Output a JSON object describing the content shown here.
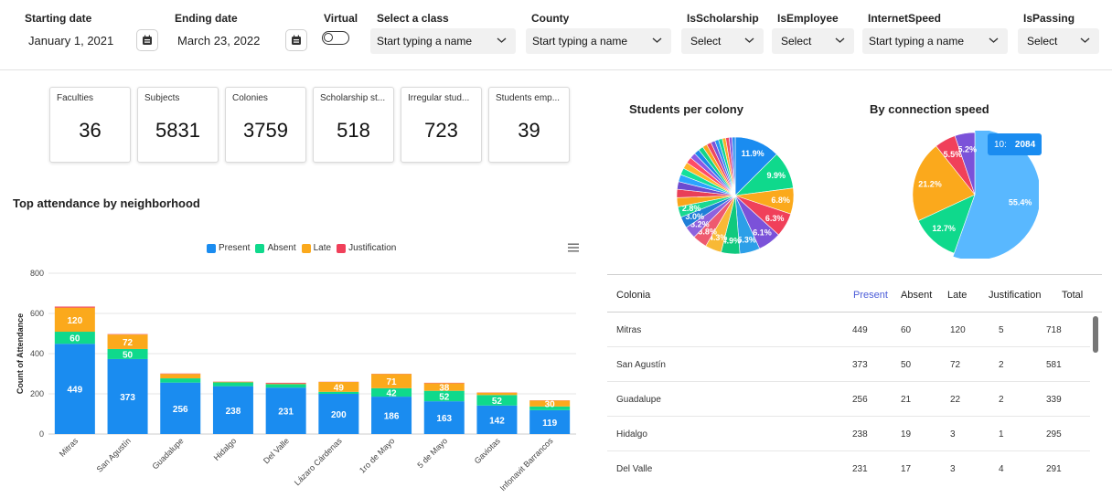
{
  "filters": {
    "start_label": "Starting date",
    "start_value": "January 1, 2021",
    "end_label": "Ending date",
    "end_value": "March 23, 2022",
    "virtual_label": "Virtual",
    "class_label": "Select a class",
    "class_placeholder": "Start typing a name",
    "county_label": "County",
    "county_placeholder": "Start typing a name",
    "scholarship_label": "IsScholarship",
    "scholarship_value": "Select",
    "employee_label": "IsEmployee",
    "employee_value": "Select",
    "internet_label": "InternetSpeed",
    "internet_placeholder": "Start typing a name",
    "passing_label": "IsPassing",
    "passing_value": "Select",
    "icons": {
      "calendar": "calendar-icon",
      "chevron": "chevron-down-icon"
    }
  },
  "kpis": [
    {
      "title": "Faculties",
      "value": "36"
    },
    {
      "title": "Subjects",
      "value": "5831"
    },
    {
      "title": "Colonies",
      "value": "3759"
    },
    {
      "title": "Scholarship st...",
      "value": "518"
    },
    {
      "title": "Irregular stud...",
      "value": "723"
    },
    {
      "title": "Students emp...",
      "value": "39"
    }
  ],
  "attendance_chart": {
    "title": "Top attendance by neighborhood",
    "legend": [
      "Present",
      "Absent",
      "Late",
      "Justification"
    ]
  },
  "pie1_title": "Students per colony",
  "pie2_title": "By connection speed",
  "tooltip": {
    "label": "10:",
    "value": "2084"
  },
  "chart_data": [
    {
      "type": "bar",
      "stacked": true,
      "title": "Top attendance by neighborhood",
      "ylabel": "Count of Attendance",
      "ylim": [
        0,
        800
      ],
      "yticks": [
        0,
        200,
        400,
        600,
        800
      ],
      "categories": [
        "Mitras",
        "San Agustín",
        "Guadalupe",
        "Hidalgo",
        "Del Valle",
        "Lázaro Cárdenas",
        "1ro de Mayo",
        "5 de Mayo",
        "Gaviotas",
        "Infonavit Barrancos"
      ],
      "series": [
        {
          "name": "Present",
          "color": "#1a8cf0",
          "values": [
            449,
            373,
            256,
            238,
            231,
            200,
            186,
            163,
            142,
            119
          ]
        },
        {
          "name": "Absent",
          "color": "#0fd98c",
          "values": [
            60,
            50,
            21,
            19,
            17,
            10,
            42,
            52,
            52,
            18
          ]
        },
        {
          "name": "Late",
          "color": "#fba91c",
          "values": [
            120,
            72,
            22,
            3,
            3,
            49,
            71,
            38,
            12,
            30
          ]
        },
        {
          "name": "Justification",
          "color": "#f0405a",
          "values": [
            5,
            2,
            2,
            1,
            4,
            1,
            1,
            2,
            1,
            1
          ]
        }
      ],
      "labels_shown_threshold": 25,
      "legend_position": "top"
    },
    {
      "type": "pie",
      "title": "Students per colony",
      "labels_visible": [
        "11.9%",
        "9.9%",
        "6.8%",
        "6.3%",
        "6.1%",
        "5.3%",
        "4.9%",
        "4.3%",
        "3.8%",
        "3.2%",
        "3.0%",
        "2.8%"
      ],
      "values": [
        11.9,
        9.9,
        6.8,
        6.3,
        6.1,
        5.3,
        4.9,
        4.3,
        3.8,
        3.2,
        3.0,
        2.8,
        2.4,
        2.2,
        2.0,
        1.9,
        1.8,
        1.7,
        1.6,
        1.5,
        1.4,
        1.3,
        1.2,
        1.2,
        1.1,
        1.0,
        1.0,
        0.9,
        0.9,
        0.8,
        0.8
      ],
      "colors": [
        "#1a8cf0",
        "#0fd98c",
        "#fba91c",
        "#f0405a",
        "#7b52d9",
        "#2c9fe8",
        "#10c97e",
        "#f8b936",
        "#ee5a6f",
        "#8e62dd",
        "#1f7fd8",
        "#19d891",
        "#f9a51a",
        "#e93f58",
        "#6c4bd0",
        "#2ba3ff",
        "#13e09b",
        "#ffb52a",
        "#ff4b66",
        "#8a59e6",
        "#1c89ea",
        "#12d488",
        "#f7a61e",
        "#ef4660",
        "#7a53da",
        "#2594f2",
        "#14d78f",
        "#f9af26",
        "#f04d64",
        "#835ce0",
        "#2a8ff0"
      ]
    },
    {
      "type": "pie",
      "title": "By connection speed",
      "categories": [
        "10",
        "blue-slice",
        "green-slice",
        "orange-slice",
        "red-slice",
        "purple-slice"
      ],
      "values": [
        55.4,
        12.7,
        21.2,
        5.5,
        5.2
      ],
      "labels": [
        "55.4%",
        "12.7%",
        "21.2%",
        "5.5%",
        "5.2%"
      ],
      "colors": [
        "#59b8ff",
        "#0fd98c",
        "#fba91c",
        "#f0405a",
        "#7b52d9"
      ]
    }
  ],
  "table": {
    "headers": [
      "Colonia",
      "Present",
      "Absent",
      "Late",
      "Justification",
      "Total"
    ],
    "rows": [
      [
        "Mitras",
        "449",
        "60",
        "120",
        "5",
        "718"
      ],
      [
        "San Agustín",
        "373",
        "50",
        "72",
        "2",
        "581"
      ],
      [
        "Guadalupe",
        "256",
        "21",
        "22",
        "2",
        "339"
      ],
      [
        "Hidalgo",
        "238",
        "19",
        "3",
        "1",
        "295"
      ],
      [
        "Del Valle",
        "231",
        "17",
        "3",
        "4",
        "291"
      ]
    ]
  }
}
